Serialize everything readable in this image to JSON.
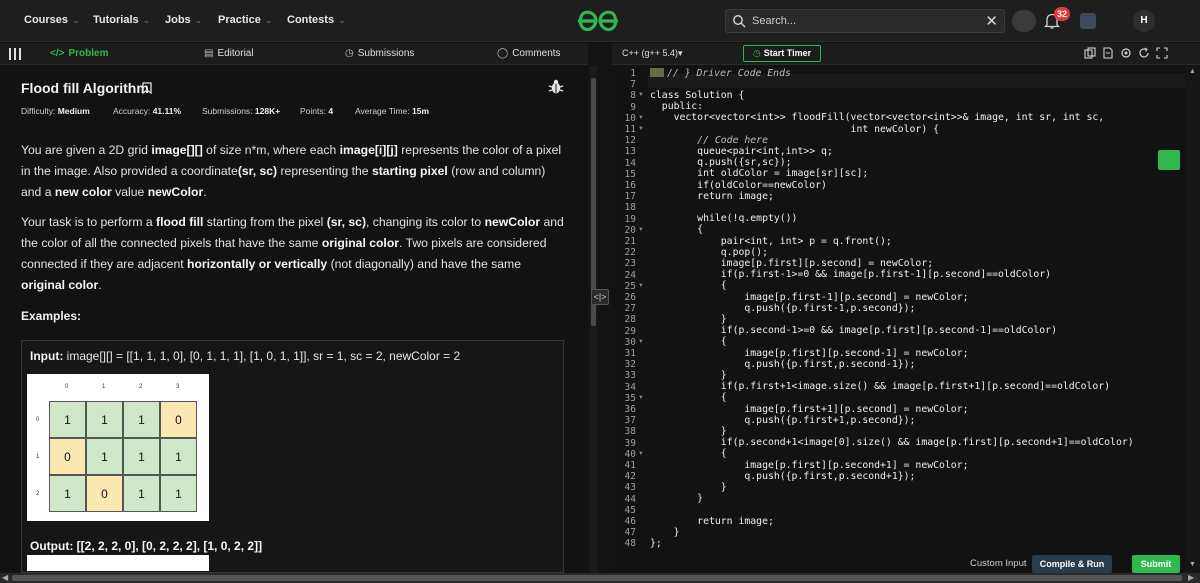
{
  "nav": {
    "items": [
      {
        "label": "Courses",
        "chevron": "⌄"
      },
      {
        "label": "Tutorials",
        "chevron": "⌄"
      },
      {
        "label": "Jobs",
        "chevron": "⌄"
      },
      {
        "label": "Practice",
        "chevron": "⌄"
      },
      {
        "label": "Contests",
        "chevron": "⌄"
      }
    ],
    "search_placeholder": "Search...",
    "search_close": "✕",
    "notification_count": "32",
    "avatar_initial": "H"
  },
  "tabs": {
    "problem": "Problem",
    "editorial": "Editorial",
    "submissions": "Submissions",
    "comments": "Comments"
  },
  "problem": {
    "title": "Flood fill Algorithm",
    "meta": [
      {
        "label": "Difficulty: ",
        "value": "Medium"
      },
      {
        "label": "Accuracy: ",
        "value": "41.11%"
      },
      {
        "label": "Submissions: ",
        "value": "128K+"
      },
      {
        "label": "Points: ",
        "value": "4"
      },
      {
        "label": "Average Time: ",
        "value": "15m"
      }
    ],
    "para1": {
      "t1": "You are given a 2D grid ",
      "b1": "image[][]",
      "t2": " of size n*m, where each ",
      "b2": "image[i][j]",
      "t3": " represents the color of a pixel in the image. Also provided a coordinate",
      "b3": "(sr, sc)",
      "t4": " representing the ",
      "b4": "starting pixel",
      "t5": " (row and column) and a ",
      "b5": "new color",
      "t6": " value ",
      "b6": "newColor",
      "t7": "."
    },
    "para2": {
      "t1": "Your task is to perform a ",
      "b1": "flood fill",
      "t2": " starting from the pixel ",
      "b2": "(sr, sc)",
      "t3": ", changing its color to ",
      "b3": "newColor",
      "t4": " and the color of all the connected pixels that have the same ",
      "b4": "original color",
      "t5": ". Two pixels are considered connected if they are adjacent ",
      "b5": "horizontally or vertically",
      "t6": " (not diagonally) and have the same ",
      "b6": "original color",
      "t7": "."
    },
    "examples_label": "Examples:",
    "example": {
      "input_label": "Input: ",
      "input_value": "image[][] = [[1, 1, 1, 0], [0, 1, 1, 1], [1, 0, 1, 1]], sr = 1, sc = 2, newColor = 2",
      "col_labels": [
        "0",
        "1",
        "2",
        "3"
      ],
      "row_labels": [
        "0",
        "1",
        "2"
      ],
      "grid": [
        [
          "1",
          "1",
          "1",
          "0"
        ],
        [
          "0",
          "1",
          "1",
          "1"
        ],
        [
          "1",
          "0",
          "1",
          "1"
        ]
      ],
      "output_label": "Output: ",
      "output_value": "[[2, 2, 2, 0], [0, 2, 2, 2], [1, 0, 2, 2]]"
    }
  },
  "editor": {
    "language": "C++ (g++ 5.4)",
    "start_timer": "Start Timer",
    "line_numbers": [
      "1",
      "7",
      "8",
      "9",
      "10",
      "11",
      "12",
      "13",
      "14",
      "15",
      "16",
      "17",
      "18",
      "19",
      "20",
      "21",
      "22",
      "23",
      "24",
      "25",
      "26",
      "27",
      "28",
      "29",
      "30",
      "31",
      "32",
      "33",
      "34",
      "35",
      "36",
      "37",
      "38",
      "39",
      "40",
      "41",
      "42",
      "43",
      "44",
      "45",
      "46",
      "47",
      "48"
    ],
    "lines": [
      "// } Driver Code Ends",
      "",
      "class Solution {",
      "  public:",
      "    vector<vector<int>> floodFill(vector<vector<int>>& image, int sr, int sc,",
      "                                  int newColor) {",
      "        // Code here",
      "        queue<pair<int,int>> q;",
      "        q.push({sr,sc});",
      "        int oldColor = image[sr][sc];",
      "        if(oldColor==newColor)",
      "        return image;",
      "",
      "        while(!q.empty())",
      "        {",
      "            pair<int, int> p = q.front();",
      "            q.pop();",
      "            image[p.first][p.second] = newColor;",
      "            if(p.first-1>=0 && image[p.first-1][p.second]==oldColor)",
      "            {",
      "                image[p.first-1][p.second] = newColor;",
      "                q.push({p.first-1,p.second});",
      "            }",
      "            if(p.second-1>=0 && image[p.first][p.second-1]==oldColor)",
      "            {",
      "                image[p.first][p.second-1] = newColor;",
      "                q.push({p.first,p.second-1});",
      "            }",
      "            if(p.first+1<image.size() && image[p.first+1][p.second]==oldColor)",
      "            {",
      "                image[p.first+1][p.second] = newColor;",
      "                q.push({p.first+1,p.second});",
      "            }",
      "            if(p.second+1<image[0].size() && image[p.first][p.second+1]==oldColor)",
      "            {",
      "                image[p.first][p.second+1] = newColor;",
      "                q.push({p.first,p.second+1});",
      "            }",
      "        }",
      "",
      "        return image;",
      "    }",
      "};"
    ],
    "custom_input": "Custom Input",
    "compile_run": "Compile & Run",
    "submit": "Submit"
  }
}
